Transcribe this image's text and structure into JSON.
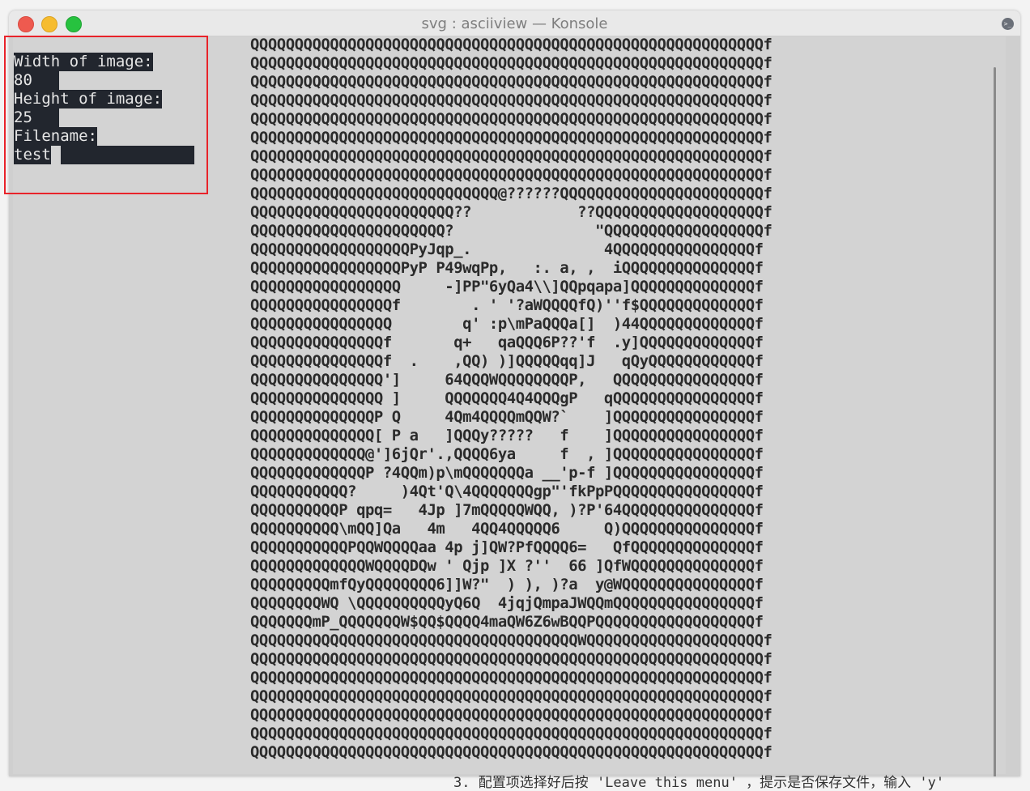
{
  "window": {
    "title": "svg : asciiview — Konsole"
  },
  "form": {
    "width_label": "Width of image:",
    "width_value": "80",
    "height_label": "Height of image:",
    "height_value": "25",
    "filename_label": "Filename:",
    "filename_value": "test"
  },
  "ascii_lines": [
    "QQQQQQQQQQQQQQQQQQQQQQQQQQQQQQQQQQQQQQQQQQQQQQQQQQQQQQQQQQf",
    "QQQQQQQQQQQQQQQQQQQQQQQQQQQQQQQQQQQQQQQQQQQQQQQQQQQQQQQQQQf",
    "QQQQQQQQQQQQQQQQQQQQQQQQQQQQQQQQQQQQQQQQQQQQQQQQQQQQQQQQQQf",
    "QQQQQQQQQQQQQQQQQQQQQQQQQQQQQQQQQQQQQQQQQQQQQQQQQQQQQQQQQQf",
    "QQQQQQQQQQQQQQQQQQQQQQQQQQQQQQQQQQQQQQQQQQQQQQQQQQQQQQQQQQf",
    "QQQQQQQQQQQQQQQQQQQQQQQQQQQQQQQQQQQQQQQQQQQQQQQQQQQQQQQQQQf",
    "QQQQQQQQQQQQQQQQQQQQQQQQQQQQQQQQQQQQQQQQQQQQQQQQQQQQQQQQQQf",
    "QQQQQQQQQQQQQQQQQQQQQQQQQQQQQQQQQQQQQQQQQQQQQQQQQQQQQQQQQQf",
    "QQQQQQQQQQQQQQQQQQQQQQQQQQQQ@??????QQQQQQQQQQQQQQQQQQQQQQQf",
    "QQQQQQQQQQQQQQQQQQQQQQQ??            ??QQQQQQQQQQQQQQQQQQQf",
    "QQQQQQQQQQQQQQQQQQQQQQ?                \"QQQQQQQQQQQQQQQQQQf",
    "QQQQQQQQQQQQQQQQQQPyJqp_.               4QQQQQQQQQQQQQQQQf",
    "QQQQQQQQQQQQQQQQQPyP P49wqPp,   :. a, ,  iQQQQQQQQQQQQQQQf",
    "QQQQQQQQQQQQQQQQQ     -]PP\"6yQa4\\\\]QQpqapa]QQQQQQQQQQQQQQf",
    "QQQQQQQQQQQQQQQQf        . ' '?aWQQQQfQ)''f$QQQQQQQQQQQQQf",
    "QQQQQQQQQQQQQQQQ        q' :p\\mPaQQQa[]  )44QQQQQQQQQQQQQf",
    "QQQQQQQQQQQQQQQf       q+   qaQQQ6P??'f  .y]QQQQQQQQQQQQQf",
    "QQQQQQQQQQQQQQQf  .    ,QQ) )]QQQQQqq]J   qQyQQQQQQQQQQQQf",
    "QQQQQQQQQQQQQQQ']     64QQQWQQQQQQQQP,   QQQQQQQQQQQQQQQQf",
    "QQQQQQQQQQQQQQQ ]     QQQQQQQ4Q4QQQgP   qQQQQQQQQQQQQQQQQf",
    "QQQQQQQQQQQQQQP Q     4Qm4QQQQmQQW?`    ]QQQQQQQQQQQQQQQQf",
    "QQQQQQQQQQQQQQ[ P a   ]QQQy?????   f    ]QQQQQQQQQQQQQQQQf",
    "QQQQQQQQQQQQQ@']6jQr'.,QQQQ6ya     f  , ]QQQQQQQQQQQQQQQQf",
    "QQQQQQQQQQQQQP ?4QQm)p\\mQQQQQQQa __'p-f ]QQQQQQQQQQQQQQQQf",
    "QQQQQQQQQQQ?     )4Qt'Q\\4QQQQQQQgp\"'fkPpPQQQQQQQQQQQQQQQQf",
    "QQQQQQQQQQP qpq=   4Jp ]7mQQQQQWQQ, )?P'64QQQQQQQQQQQQQQQf",
    "QQQQQQQQQQ\\mQQ]Qa   4m   4QQ4QQQQQ6     Q)QQQQQQQQQQQQQQQf",
    "QQQQQQQQQQQPQQWQQQQaa 4p j]QW?PfQQQQ6=   QfQQQQQQQQQQQQQQf",
    "QQQQQQQQQQQQQWQQQQDQw ' Qjp ]X ?''  66 ]QfWQQQQQQQQQQQQQQf",
    "QQQQQQQQQmfQyQQQQQQQQ6]]W?\"  ) ), )?a  y@WQQQQQQQQQQQQQQQf",
    "QQQQQQQQWQ \\QQQQQQQQQQyQ6Q  4jqjQmpaJWQQmQQQQQQQQQQQQQQQQf",
    "QQQQQQQmP_QQQQQQQW$QQ$QQQQ4maQW6Z6wBQQPQQQQQQQQQQQQQQQQQQf",
    "QQQQQQQQQQQQQQQQQQQQQQQQQQQQQQQQQQQQQWQQQQQQQQQQQQQQQQQQQQf",
    "QQQQQQQQQQQQQQQQQQQQQQQQQQQQQQQQQQQQQQQQQQQQQQQQQQQQQQQQQQf",
    "QQQQQQQQQQQQQQQQQQQQQQQQQQQQQQQQQQQQQQQQQQQQQQQQQQQQQQQQQQf",
    "QQQQQQQQQQQQQQQQQQQQQQQQQQQQQQQQQQQQQQQQQQQQQQQQQQQQQQQQQQf",
    "QQQQQQQQQQQQQQQQQQQQQQQQQQQQQQQQQQQQQQQQQQQQQQQQQQQQQQQQQQf",
    "QQQQQQQQQQQQQQQQQQQQQQQQQQQQQQQQQQQQQQQQQQQQQQQQQQQQQQQQQQf",
    "QQQQQQQQQQQQQQQQQQQQQQQQQQQQQQQQQQQQQQQQQQQQQQQQQQQQQQQQQQf"
  ],
  "underlying_text": "3. 配置项选择好后按 'Leave this menu' ，提示是否保存文件，输入 'y'"
}
